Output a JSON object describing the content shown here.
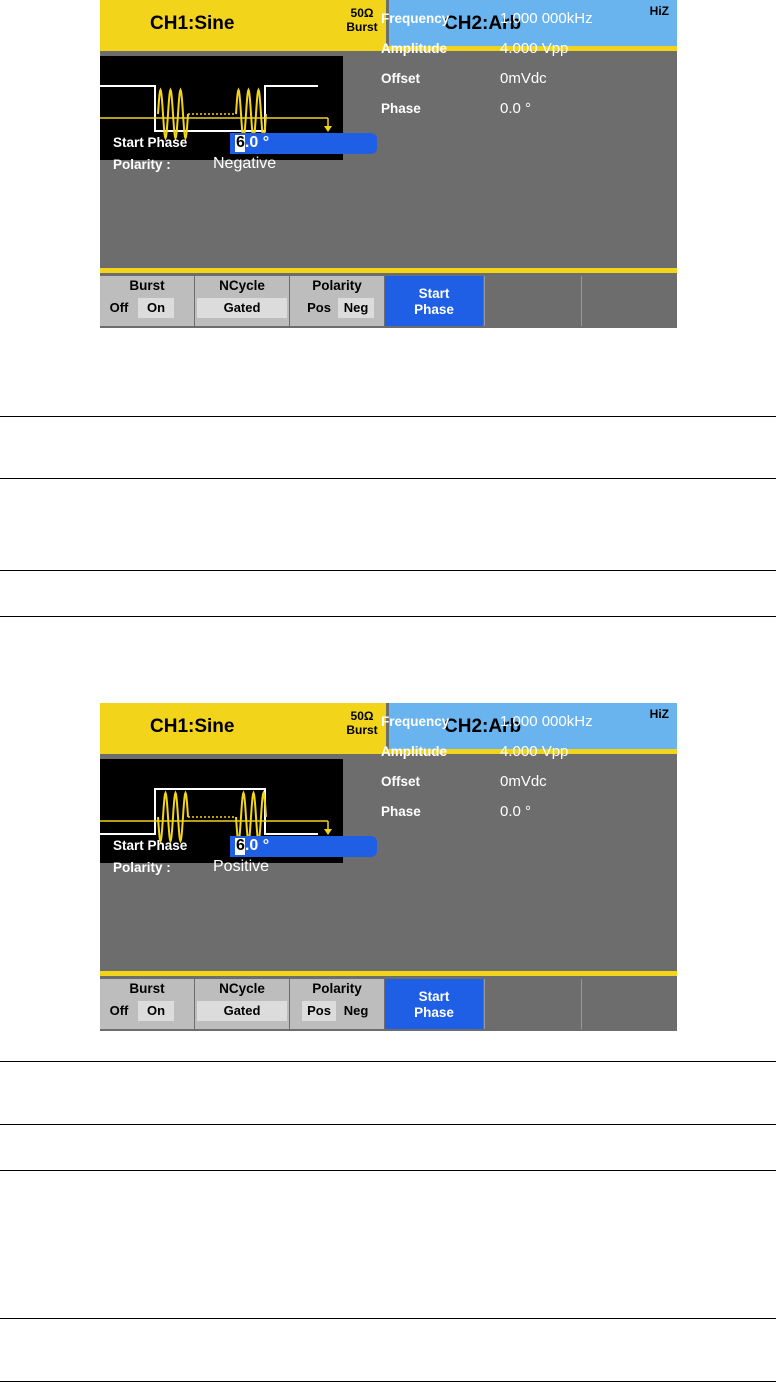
{
  "screens": [
    {
      "ch1_title": "CH1:Sine",
      "load_line1": "50Ω",
      "load_line2": "Burst",
      "ch2_title": "CH2:Arb",
      "ch2_load": "HiZ",
      "params": [
        {
          "label": "Frequency",
          "value": "1.000 000kHz"
        },
        {
          "label": "Amplitude",
          "value": "4.000 Vpp"
        },
        {
          "label": "Offset",
          "value": "0mVdc"
        },
        {
          "label": "Phase",
          "value": "0.0 °"
        }
      ],
      "start_phase_label": "Start Phase",
      "start_phase_cursor_digit": "6",
      "start_phase_rest": ".0 °",
      "polarity_label": "Polarity :",
      "polarity_value": "Negative",
      "waveform_polarity": "negative",
      "softkeys": {
        "burst_label": "Burst",
        "burst_off": "Off",
        "burst_on": "On",
        "ncycle_label": "NCycle",
        "ncycle_value": "Gated",
        "polarity_label": "Polarity",
        "polarity_pos": "Pos",
        "polarity_neg": "Neg",
        "start_label_1": "Start",
        "start_label_2": "Phase"
      },
      "selected_polarity_option": "Neg"
    },
    {
      "ch1_title": "CH1:Sine",
      "load_line1": "50Ω",
      "load_line2": "Burst",
      "ch2_title": "CH2:Arb",
      "ch2_load": "HiZ",
      "params": [
        {
          "label": "Frequency",
          "value": "1.000 000kHz"
        },
        {
          "label": "Amplitude",
          "value": "4.000 Vpp"
        },
        {
          "label": "Offset",
          "value": "0mVdc"
        },
        {
          "label": "Phase",
          "value": "0.0 °"
        }
      ],
      "start_phase_label": "Start Phase",
      "start_phase_cursor_digit": "6",
      "start_phase_rest": ".0 °",
      "polarity_label": "Polarity :",
      "polarity_value": "Positive",
      "waveform_polarity": "positive",
      "softkeys": {
        "burst_label": "Burst",
        "burst_off": "Off",
        "burst_on": "On",
        "ncycle_label": "NCycle",
        "ncycle_value": "Gated",
        "polarity_label": "Polarity",
        "polarity_pos": "Pos",
        "polarity_neg": "Neg",
        "start_label_1": "Start",
        "start_label_2": "Phase"
      },
      "selected_polarity_option": "Pos"
    }
  ],
  "colors": {
    "yellow": "#f2d41a",
    "light_blue": "#69b3ee",
    "panel_gray": "#6d6d6d",
    "field_blue": "#1f5fe5"
  }
}
